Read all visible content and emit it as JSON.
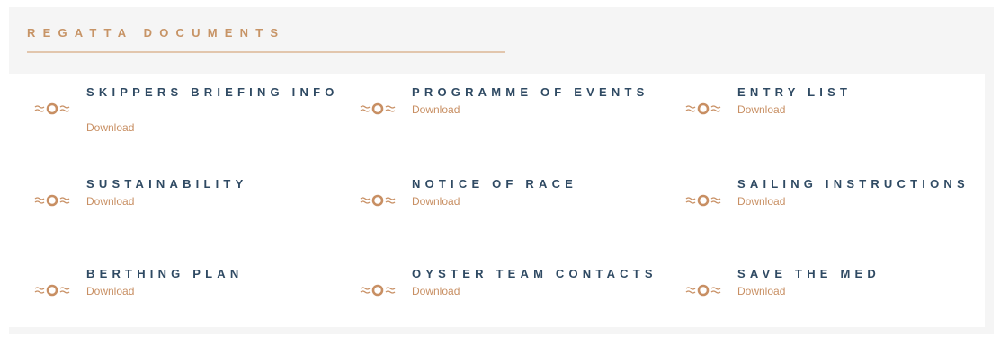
{
  "section": {
    "title": "REGATTA DOCUMENTS"
  },
  "theme": {
    "accent": "#c79466",
    "heading": "#2f4a63",
    "link": "#c88f63"
  },
  "documents": [
    {
      "name": "SKIPPERS BRIEFING INFO",
      "link": "Download",
      "icon": "oyster-wave-icon"
    },
    {
      "name": "PROGRAMME OF EVENTS",
      "link": "Download",
      "icon": "oyster-wave-icon"
    },
    {
      "name": "ENTRY LIST",
      "link": "Download",
      "icon": "oyster-wave-icon"
    },
    {
      "name": "SUSTAINABILITY",
      "link": "Download",
      "icon": "oyster-wave-icon"
    },
    {
      "name": "NOTICE OF RACE",
      "link": "Download",
      "icon": "oyster-wave-icon"
    },
    {
      "name": "SAILING INSTRUCTIONS",
      "link": "Download",
      "icon": "oyster-wave-icon"
    },
    {
      "name": "BERTHING PLAN",
      "link": "Download",
      "icon": "oyster-wave-icon"
    },
    {
      "name": "OYSTER TEAM CONTACTS",
      "link": "Download",
      "icon": "oyster-wave-icon"
    },
    {
      "name": "SAVE THE MED",
      "link": "Download",
      "icon": "oyster-wave-icon"
    }
  ]
}
